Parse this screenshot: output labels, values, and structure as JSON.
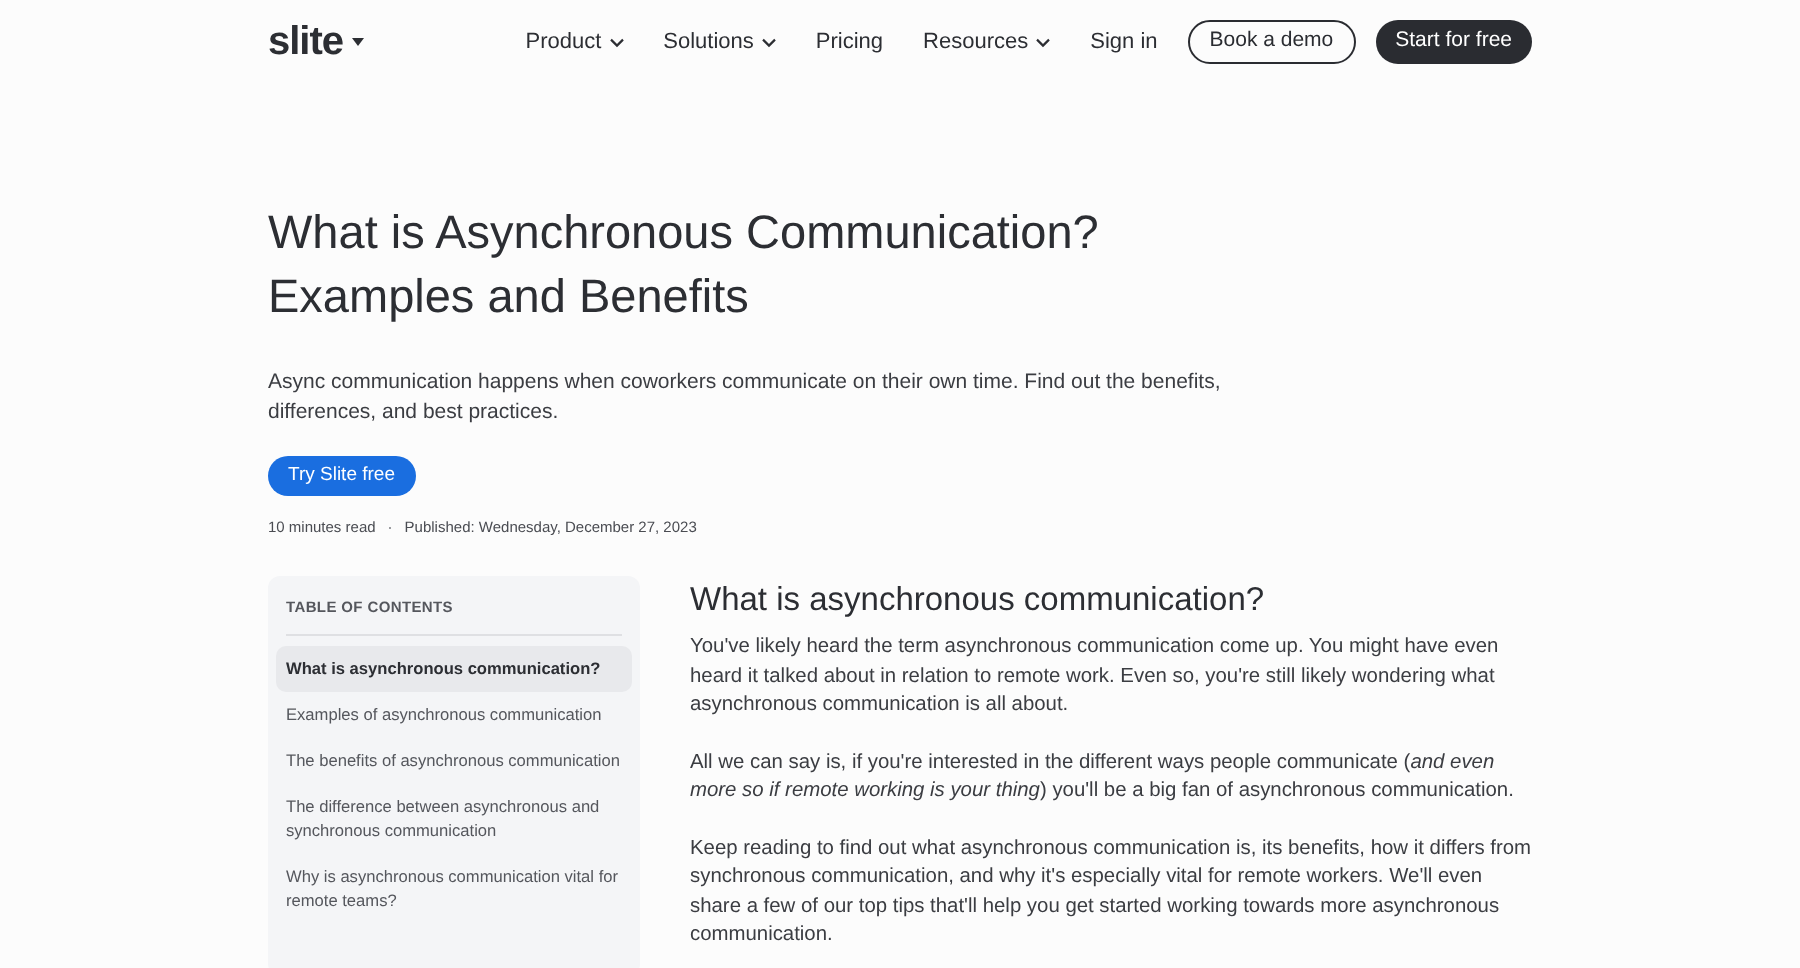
{
  "header": {
    "logo": "slite",
    "nav": [
      {
        "label": "Product",
        "dropdown": true
      },
      {
        "label": "Solutions",
        "dropdown": true
      },
      {
        "label": "Pricing",
        "dropdown": false
      },
      {
        "label": "Resources",
        "dropdown": true
      },
      {
        "label": "Sign in",
        "dropdown": false
      }
    ],
    "buttons": [
      {
        "label": "Book a demo",
        "kind": "outline"
      },
      {
        "label": "Start for free",
        "kind": "solid"
      }
    ]
  },
  "hero": {
    "title_lines": [
      "What is Asynchronous Communication?",
      "Examples and Benefits"
    ],
    "subtitle": "Async communication happens when coworkers communicate on their own time. Find out the benefits, differences, and best practices.",
    "cta": "Try Slite free",
    "read_time": "10 minutes read",
    "separator": "·",
    "published": "Published: Wednesday, December 27, 2023"
  },
  "toc": {
    "heading": "TABLE OF CONTENTS",
    "items": [
      {
        "label": "What is asynchronous communication?",
        "selected": true
      },
      {
        "label": "Examples of asynchronous communication",
        "selected": false
      },
      {
        "label": "The benefits of asynchronous communication",
        "selected": false
      },
      {
        "label": "The difference between asynchronous and synchronous communication",
        "selected": false
      },
      {
        "label": "Why is asynchronous communication vital for remote teams?",
        "selected": false
      }
    ]
  },
  "article": {
    "heading": "What is asynchronous communication?",
    "paragraphs": [
      "You've likely heard the term asynchronous communication come up. You might have even heard it talked about in relation to remote work. Even so, you're still likely wondering what asynchronous communication is all about.",
      "All we can say is, if you're interested in the different ways people communicate (*and even more so if remote working is your thing*) you'll be a big fan of asynchronous communication.",
      "Keep reading to find out what asynchronous communication is, its benefits, how it differs from synchronous communication, and why it's especially vital for remote workers. We'll even share a few of our top tips that'll help you get started working towards more asynchronous communication."
    ]
  }
}
